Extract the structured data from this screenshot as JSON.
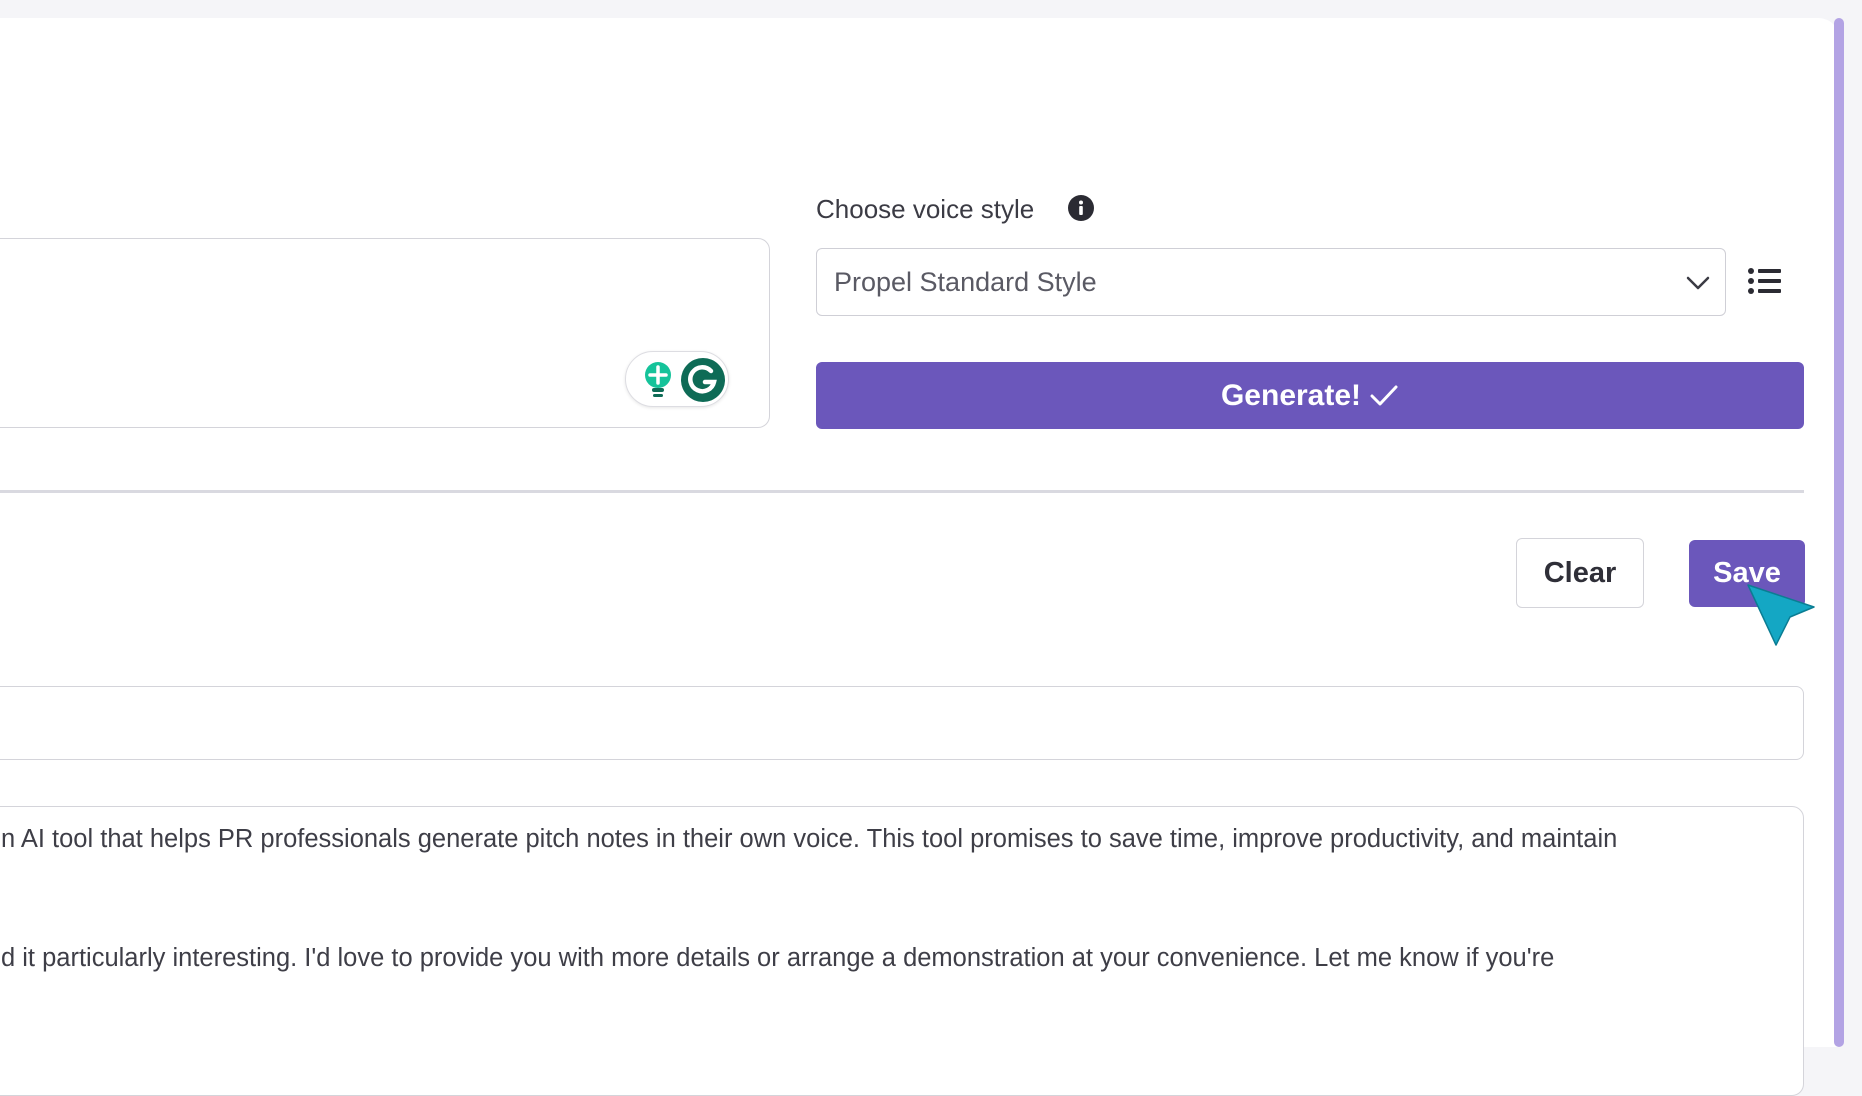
{
  "voice_style": {
    "label": "Choose voice style",
    "selected": "Propel Standard Style"
  },
  "actions": {
    "generate_label": "Generate!",
    "clear_label": "Clear",
    "save_label": "Save"
  },
  "output": {
    "line1": "n AI tool that helps PR professionals generate pitch notes in their own voice. This tool promises to save time, improve productivity, and maintain",
    "line2": "d it particularly interesting. I'd love to provide you with more details or arrange a demonstration at your convenience. Let me know if you're"
  },
  "icons": {
    "info": "info-icon",
    "chevron": "chevron-down-icon",
    "list": "list-icon",
    "check": "check-icon",
    "grammarly_bulb": "bulb-icon",
    "grammarly_g": "grammarly-icon",
    "cursor": "cursor-pointer-icon"
  },
  "colors": {
    "accent": "#6b57bb",
    "scroll_accent": "#b3a3e4",
    "grammarly_green": "#15c39a",
    "grammarly_dark": "#0e6b56",
    "cursor": "#14a7c4"
  }
}
